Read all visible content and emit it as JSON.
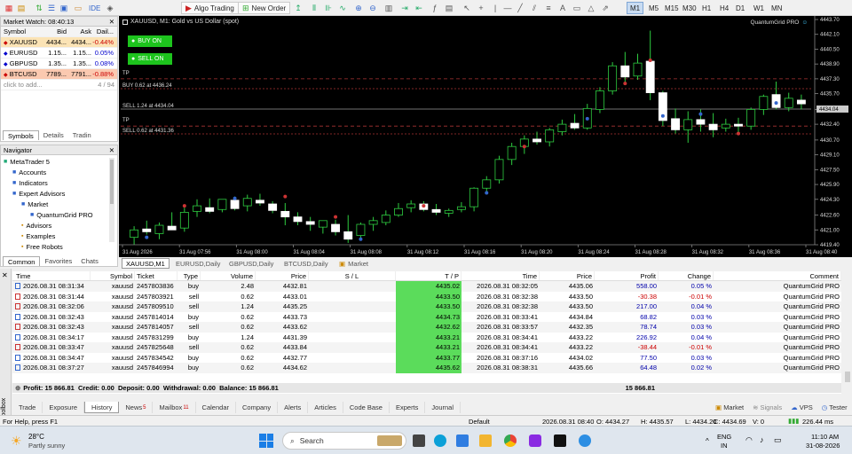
{
  "toolbar": {
    "algo_label": "Algo Trading",
    "neworder_label": "New Order",
    "ide_label": "IDE",
    "timeframes": [
      "M1",
      "M5",
      "M15",
      "M30",
      "H1",
      "H4",
      "D1",
      "W1",
      "MN"
    ],
    "active_tf": "M1"
  },
  "market_watch": {
    "title": "Market Watch: 08:40:13",
    "headers": [
      "Symbol",
      "Bid",
      "Ask",
      "Dail..."
    ],
    "rows": [
      {
        "symbol": "XAUUSD",
        "bid": "4434...",
        "ask": "4434...",
        "daily": "-0.44%",
        "bg": "#fbe3b5",
        "color": "#c00"
      },
      {
        "symbol": "EURUSD",
        "bid": "1.15...",
        "ask": "1.15...",
        "daily": "0.05%",
        "bg": "#ffffff",
        "color": "#00c"
      },
      {
        "symbol": "GBPUSD",
        "bid": "1.35...",
        "ask": "1.35...",
        "daily": "0.08%",
        "bg": "#ffffff",
        "color": "#00c"
      },
      {
        "symbol": "BTCUSD",
        "bid": "7789...",
        "ask": "7791...",
        "daily": "-0.88%",
        "bg": "#fbc9b0",
        "color": "#c00"
      }
    ],
    "add_label": "click to add...",
    "count": "4 / 94",
    "tabs": [
      "Symbols",
      "Details",
      "Tradin"
    ]
  },
  "navigator": {
    "title": "Navigator",
    "items": [
      {
        "label": "MetaTrader 5",
        "indent": 0
      },
      {
        "label": "Accounts",
        "indent": 1
      },
      {
        "label": "Indicators",
        "indent": 1
      },
      {
        "label": "Expert Advisors",
        "indent": 1
      },
      {
        "label": "Market",
        "indent": 2
      },
      {
        "label": "QuantumGrid PRO",
        "indent": 3
      },
      {
        "label": "Advisors",
        "indent": 2
      },
      {
        "label": "Examples",
        "indent": 2
      },
      {
        "label": "Free Robots",
        "indent": 2
      }
    ],
    "tabs": [
      "Common",
      "Favorites",
      "Chats"
    ]
  },
  "chart": {
    "title": "XAUUSD, M1:  Gold vs US Dollar (spot)",
    "ea_label": "QuantumGrid PRO",
    "buy_btn": "BUY ON",
    "sell_btn": "SELL ON",
    "line_labels": [
      "TP",
      "BUY 0.62 at 4436.24",
      "SELL 1.24 at 4434.04",
      "TP",
      "SELL 0.62 at 4431.36"
    ],
    "price_ticks": [
      "4443.70",
      "4442.10",
      "4440.50",
      "4438.90",
      "4437.30",
      "4435.70",
      "4434.00",
      "4432.40",
      "4430.70",
      "4429.10",
      "4427.50",
      "4425.90",
      "4424.30",
      "4422.60",
      "4421.00",
      "4419.40"
    ],
    "current_price": "4434.04",
    "time_ticks": [
      "31 Aug 2026",
      "31 Aug 07:56",
      "31 Aug 08:00",
      "31 Aug 08:04",
      "31 Aug 08:08",
      "31 Aug 08:12",
      "31 Aug 08:16",
      "31 Aug 08:20",
      "31 Aug 08:24",
      "31 Aug 08:28",
      "31 Aug 08:32",
      "31 Aug 08:36",
      "31 Aug 08:40"
    ],
    "tabs": [
      "XAUUSD,M1",
      "EURUSD,Daily",
      "GBPUSD,Daily",
      "BTCUSD,Daily",
      "Market"
    ]
  },
  "chart_data": {
    "type": "candlestick",
    "symbol": "XAUUSD",
    "timeframe": "M1",
    "ylim": [
      4419.4,
      4443.7
    ],
    "candles": [
      {
        "o": 4420.2,
        "h": 4421.4,
        "l": 4419.4,
        "c": 4421.0
      },
      {
        "o": 4421.1,
        "h": 4422.0,
        "l": 4420.5,
        "c": 4420.8
      },
      {
        "o": 4420.6,
        "h": 4421.8,
        "l": 4420.0,
        "c": 4421.5
      },
      {
        "o": 4421.4,
        "h": 4422.9,
        "l": 4421.0,
        "c": 4421.0
      },
      {
        "o": 4421.2,
        "h": 4423.4,
        "l": 4420.8,
        "c": 4422.9
      },
      {
        "o": 4423.0,
        "h": 4424.3,
        "l": 4422.4,
        "c": 4423.6
      },
      {
        "o": 4423.4,
        "h": 4424.4,
        "l": 4422.8,
        "c": 4423.0
      },
      {
        "o": 4423.2,
        "h": 4424.0,
        "l": 4422.9,
        "c": 4424.3
      },
      {
        "o": 4424.2,
        "h": 4424.6,
        "l": 4423.1,
        "c": 4423.3
      },
      {
        "o": 4423.6,
        "h": 4424.8,
        "l": 4423.0,
        "c": 4424.4
      },
      {
        "o": 4424.2,
        "h": 4424.9,
        "l": 4423.6,
        "c": 4423.9
      },
      {
        "o": 4423.8,
        "h": 4424.1,
        "l": 4422.8,
        "c": 4423.1
      },
      {
        "o": 4423.0,
        "h": 4423.9,
        "l": 4421.5,
        "c": 4422.4
      },
      {
        "o": 4422.4,
        "h": 4422.9,
        "l": 4421.5,
        "c": 4421.9
      },
      {
        "o": 4421.9,
        "h": 4422.4,
        "l": 4420.9,
        "c": 4421.6
      },
      {
        "o": 4421.3,
        "h": 4421.8,
        "l": 4420.6,
        "c": 4422.0
      },
      {
        "o": 4421.6,
        "h": 4422.1,
        "l": 4420.4,
        "c": 4420.8
      },
      {
        "o": 4420.8,
        "h": 4422.6,
        "l": 4419.6,
        "c": 4420.0
      },
      {
        "o": 4420.4,
        "h": 4421.8,
        "l": 4420.0,
        "c": 4421.6
      },
      {
        "o": 4421.6,
        "h": 4422.4,
        "l": 4420.9,
        "c": 4422.0
      },
      {
        "o": 4421.8,
        "h": 4423.1,
        "l": 4421.5,
        "c": 4422.6
      },
      {
        "o": 4422.6,
        "h": 4423.9,
        "l": 4422.4,
        "c": 4423.3
      },
      {
        "o": 4423.4,
        "h": 4424.2,
        "l": 4422.9,
        "c": 4423.8
      },
      {
        "o": 4423.8,
        "h": 4424.1,
        "l": 4423.0,
        "c": 4423.2
      },
      {
        "o": 4423.2,
        "h": 4423.8,
        "l": 4422.6,
        "c": 4422.9
      },
      {
        "o": 4422.8,
        "h": 4423.3,
        "l": 4422.4,
        "c": 4423.1
      },
      {
        "o": 4423.2,
        "h": 4424.0,
        "l": 4422.9,
        "c": 4423.5
      },
      {
        "o": 4423.5,
        "h": 4425.6,
        "l": 4423.0,
        "c": 4425.5
      },
      {
        "o": 4425.5,
        "h": 4426.8,
        "l": 4425.0,
        "c": 4426.4
      },
      {
        "o": 4426.4,
        "h": 4429.0,
        "l": 4426.0,
        "c": 4428.6
      },
      {
        "o": 4428.6,
        "h": 4430.4,
        "l": 4428.0,
        "c": 4430.0
      },
      {
        "o": 4430.0,
        "h": 4431.2,
        "l": 4429.2,
        "c": 4430.8
      },
      {
        "o": 4430.8,
        "h": 4431.6,
        "l": 4430.2,
        "c": 4430.5
      },
      {
        "o": 4430.5,
        "h": 4432.0,
        "l": 4430.0,
        "c": 4431.8
      },
      {
        "o": 4431.6,
        "h": 4432.9,
        "l": 4431.2,
        "c": 4432.4
      },
      {
        "o": 4432.5,
        "h": 4433.5,
        "l": 4431.8,
        "c": 4432.0
      },
      {
        "o": 4432.0,
        "h": 4434.6,
        "l": 4431.8,
        "c": 4434.1
      },
      {
        "o": 4434.0,
        "h": 4436.4,
        "l": 4433.6,
        "c": 4436.0
      },
      {
        "o": 4436.0,
        "h": 4439.1,
        "l": 4435.6,
        "c": 4438.7
      },
      {
        "o": 4438.7,
        "h": 4440.2,
        "l": 4436.8,
        "c": 4437.5
      },
      {
        "o": 4437.6,
        "h": 4440.0,
        "l": 4437.2,
        "c": 4439.0
      },
      {
        "o": 4439.2,
        "h": 4442.5,
        "l": 4435.0,
        "c": 4435.8
      },
      {
        "o": 4435.8,
        "h": 4436.0,
        "l": 4432.2,
        "c": 4432.8
      },
      {
        "o": 4433.0,
        "h": 4434.1,
        "l": 4431.4,
        "c": 4431.8
      },
      {
        "o": 4431.8,
        "h": 4433.8,
        "l": 4430.4,
        "c": 4432.9
      },
      {
        "o": 4432.9,
        "h": 4434.0,
        "l": 4431.6,
        "c": 4432.4
      },
      {
        "o": 4432.4,
        "h": 4433.6,
        "l": 4431.0,
        "c": 4431.8
      },
      {
        "o": 4432.0,
        "h": 4433.0,
        "l": 4431.6,
        "c": 4432.4
      },
      {
        "o": 4432.4,
        "h": 4433.1,
        "l": 4431.4,
        "c": 4432.2
      },
      {
        "o": 4432.2,
        "h": 4434.2,
        "l": 4431.8,
        "c": 4434.0
      },
      {
        "o": 4434.0,
        "h": 4435.6,
        "l": 4433.4,
        "c": 4435.4
      },
      {
        "o": 4435.6,
        "h": 4437.0,
        "l": 4434.0,
        "c": 4434.2
      },
      {
        "o": 4434.2,
        "h": 4435.8,
        "l": 4433.8,
        "c": 4435.2
      },
      {
        "o": 4435.0,
        "h": 4435.6,
        "l": 4434.0,
        "c": 4434.6
      }
    ]
  },
  "positions": {
    "headers": [
      "Time",
      "Symbol",
      "Ticket",
      "Type",
      "Volume",
      "Price",
      "S / L",
      "T / P",
      "Time",
      "Price",
      "Profit",
      "Change",
      "Comment"
    ],
    "rows": [
      [
        "2026.08.31 08:31:34",
        "xauusd",
        "2457803836",
        "buy",
        "2.48",
        "4432.81",
        "",
        "4435.02",
        "2026.08.31 08:32:05",
        "4435.06",
        "558.00",
        "0.05 %",
        "QuantumGrid PRO"
      ],
      [
        "2026.08.31 08:31:44",
        "xauusd",
        "2457803921",
        "sell",
        "0.62",
        "4433.01",
        "",
        "4433.50",
        "2026.08.31 08:32:38",
        "4433.50",
        "-30.38",
        "-0.01 %",
        "QuantumGrid PRO"
      ],
      [
        "2026.08.31 08:32:06",
        "xauusd",
        "2457809510",
        "sell",
        "1.24",
        "4435.25",
        "",
        "4433.50",
        "2026.08.31 08:32:38",
        "4433.50",
        "217.00",
        "0.04 %",
        "QuantumGrid PRO"
      ],
      [
        "2026.08.31 08:32:43",
        "xauusd",
        "2457814014",
        "buy",
        "0.62",
        "4433.73",
        "",
        "4434.73",
        "2026.08.31 08:33:41",
        "4434.84",
        "68.82",
        "0.03 %",
        "QuantumGrid PRO"
      ],
      [
        "2026.08.31 08:32:43",
        "xauusd",
        "2457814057",
        "sell",
        "0.62",
        "4433.62",
        "",
        "4432.62",
        "2026.08.31 08:33:57",
        "4432.35",
        "78.74",
        "0.03 %",
        "QuantumGrid PRO"
      ],
      [
        "2026.08.31 08:34:17",
        "xauusd",
        "2457831299",
        "buy",
        "1.24",
        "4431.39",
        "",
        "4433.21",
        "2026.08.31 08:34:41",
        "4433.22",
        "226.92",
        "0.04 %",
        "QuantumGrid PRO"
      ],
      [
        "2026.08.31 08:33:47",
        "xauusd",
        "2457825648",
        "sell",
        "0.62",
        "4433.84",
        "",
        "4433.21",
        "2026.08.31 08:34:41",
        "4433.22",
        "-38.44",
        "-0.01 %",
        "QuantumGrid PRO"
      ],
      [
        "2026.08.31 08:34:47",
        "xauusd",
        "2457834542",
        "buy",
        "0.62",
        "4432.77",
        "",
        "4433.77",
        "2026.08.31 08:37:16",
        "4434.02",
        "77.50",
        "0.03 %",
        "QuantumGrid PRO"
      ],
      [
        "2026.08.31 08:37:27",
        "xauusd",
        "2457846994",
        "buy",
        "0.62",
        "4434.62",
        "",
        "4435.62",
        "2026.08.31 08:38:31",
        "4435.66",
        "64.48",
        "0.02 %",
        "QuantumGrid PRO"
      ]
    ],
    "summary": "Profit: 15 866.81  Credit: 0.00  Deposit: 0.00  Withdrawal: 0.00  Balance: 15 866.81",
    "summary_total": "15 866.81"
  },
  "bottom_tabs": [
    {
      "label": "Trade",
      "badge": ""
    },
    {
      "label": "Exposure",
      "badge": ""
    },
    {
      "label": "History",
      "badge": ""
    },
    {
      "label": "News",
      "badge": "5"
    },
    {
      "label": "Mailbox",
      "badge": "11"
    },
    {
      "label": "Calendar",
      "badge": ""
    },
    {
      "label": "Company",
      "badge": ""
    },
    {
      "label": "Alerts",
      "badge": ""
    },
    {
      "label": "Articles",
      "badge": ""
    },
    {
      "label": "Code Base",
      "badge": ""
    },
    {
      "label": "Experts",
      "badge": ""
    },
    {
      "label": "Journal",
      "badge": ""
    }
  ],
  "bottom_right": {
    "market": "Market",
    "signals": "Signals",
    "vps": "VPS",
    "tester": "Tester"
  },
  "toolbox_label": "Toolbox",
  "status": {
    "help": "For Help, press F1",
    "profile": "Default",
    "datetime": "2026.08.31 08:40",
    "o": "O: 4434.27",
    "h": "H: 4435.57",
    "l": "L: 4434.20",
    "c": "C: 4434.69",
    "v": "V: 0",
    "net": "226.44 ms"
  },
  "taskbar": {
    "temp": "28°C",
    "weather": "Partly sunny",
    "search": "Search",
    "lang1": "ENG",
    "lang2": "IN",
    "time": "11:10 AM",
    "date": "31-08-2026"
  }
}
